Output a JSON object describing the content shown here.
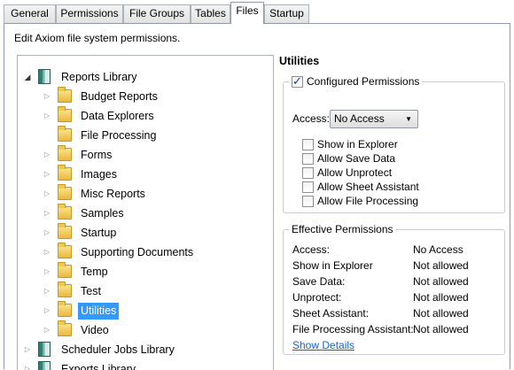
{
  "tabs": [
    {
      "label": "General"
    },
    {
      "label": "Permissions"
    },
    {
      "label": "File Groups"
    },
    {
      "label": "Tables"
    },
    {
      "label": "Files",
      "active": true
    },
    {
      "label": "Startup"
    }
  ],
  "description": "Edit Axiom file system permissions.",
  "tree": {
    "nodes": [
      {
        "label": "Reports Library",
        "icon": "library-icon",
        "level": 0,
        "expanded": true
      },
      {
        "label": "Budget Reports",
        "icon": "folder-icon",
        "level": 1,
        "expandable": true
      },
      {
        "label": "Data Explorers",
        "icon": "folder-icon",
        "level": 1,
        "expandable": true
      },
      {
        "label": "File Processing",
        "icon": "folder-icon",
        "level": 1,
        "expandable": false
      },
      {
        "label": "Forms",
        "icon": "folder-icon",
        "level": 1,
        "expandable": true
      },
      {
        "label": "Images",
        "icon": "folder-icon",
        "level": 1,
        "expandable": true
      },
      {
        "label": "Misc Reports",
        "icon": "folder-icon",
        "level": 1,
        "expandable": true
      },
      {
        "label": "Samples",
        "icon": "folder-icon",
        "level": 1,
        "expandable": true
      },
      {
        "label": "Startup",
        "icon": "folder-icon",
        "level": 1,
        "expandable": true
      },
      {
        "label": "Supporting Documents",
        "icon": "folder-icon",
        "level": 1,
        "expandable": true
      },
      {
        "label": "Temp",
        "icon": "folder-icon",
        "level": 1,
        "expandable": true
      },
      {
        "label": "Test",
        "icon": "folder-icon",
        "level": 1,
        "expandable": true
      },
      {
        "label": "Utilities",
        "icon": "folder-icon",
        "level": 1,
        "expandable": true,
        "selected": true
      },
      {
        "label": "Video",
        "icon": "folder-icon",
        "level": 1,
        "expandable": true
      },
      {
        "label": "Scheduler Jobs Library",
        "icon": "library-icon",
        "level": 0,
        "expandable": true
      },
      {
        "label": "Exports Library",
        "icon": "library-icon",
        "level": 0,
        "expandable": true
      }
    ]
  },
  "details": {
    "title": "Utilities",
    "configured": {
      "label": "Configured Permissions",
      "checked": true,
      "access_label": "Access:",
      "access_value": "No Access",
      "options": [
        {
          "label": "Show in Explorer",
          "checked": false
        },
        {
          "label": "Allow Save Data",
          "checked": false
        },
        {
          "label": "Allow Unprotect",
          "checked": false
        },
        {
          "label": "Allow Sheet Assistant",
          "checked": false
        },
        {
          "label": "Allow File Processing",
          "checked": false
        }
      ]
    },
    "effective": {
      "label": "Effective Permissions",
      "rows": [
        {
          "key": "Access:",
          "value": "No Access"
        },
        {
          "key": "Show in Explorer",
          "value": "Not allowed"
        },
        {
          "key": "Save Data:",
          "value": "Not allowed"
        },
        {
          "key": "Unprotect:",
          "value": "Not allowed"
        },
        {
          "key": "Sheet Assistant:",
          "value": "Not allowed"
        },
        {
          "key": "File Processing Assistant:",
          "value": "Not allowed"
        }
      ],
      "link": "Show Details"
    }
  },
  "colors": {
    "selection": "#3399ff",
    "link": "#1565c0"
  }
}
